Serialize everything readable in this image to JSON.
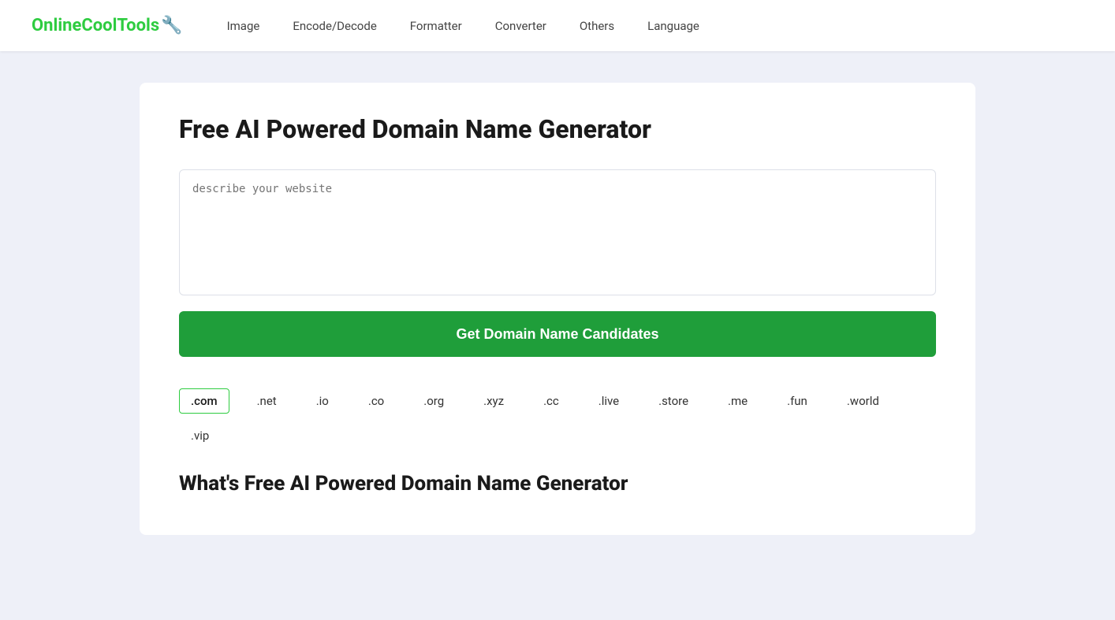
{
  "header": {
    "logo_text": "OnlineCoolTools",
    "logo_icon": "✕",
    "nav_items": [
      {
        "label": "Image",
        "id": "image"
      },
      {
        "label": "Encode/Decode",
        "id": "encode-decode"
      },
      {
        "label": "Formatter",
        "id": "formatter"
      },
      {
        "label": "Converter",
        "id": "converter"
      },
      {
        "label": "Others",
        "id": "others"
      },
      {
        "label": "Language",
        "id": "language"
      }
    ]
  },
  "main": {
    "page_title": "Free AI Powered Domain Name Generator",
    "textarea_placeholder": "describe your website",
    "generate_button_label": "Get Domain Name Candidates",
    "tld_options": [
      {
        "label": ".com",
        "active": true
      },
      {
        "label": ".net",
        "active": false
      },
      {
        "label": ".io",
        "active": false
      },
      {
        "label": ".co",
        "active": false
      },
      {
        "label": ".org",
        "active": false
      },
      {
        "label": ".xyz",
        "active": false
      },
      {
        "label": ".cc",
        "active": false
      },
      {
        "label": ".live",
        "active": false
      },
      {
        "label": ".store",
        "active": false
      },
      {
        "label": ".me",
        "active": false
      },
      {
        "label": ".fun",
        "active": false
      },
      {
        "label": ".world",
        "active": false
      },
      {
        "label": ".vip",
        "active": false
      }
    ],
    "section_title": "What's Free AI Powered Domain Name Generator"
  },
  "colors": {
    "logo_green": "#2ecc40",
    "button_green": "#1f9e3a",
    "active_border": "#2ecc40"
  }
}
